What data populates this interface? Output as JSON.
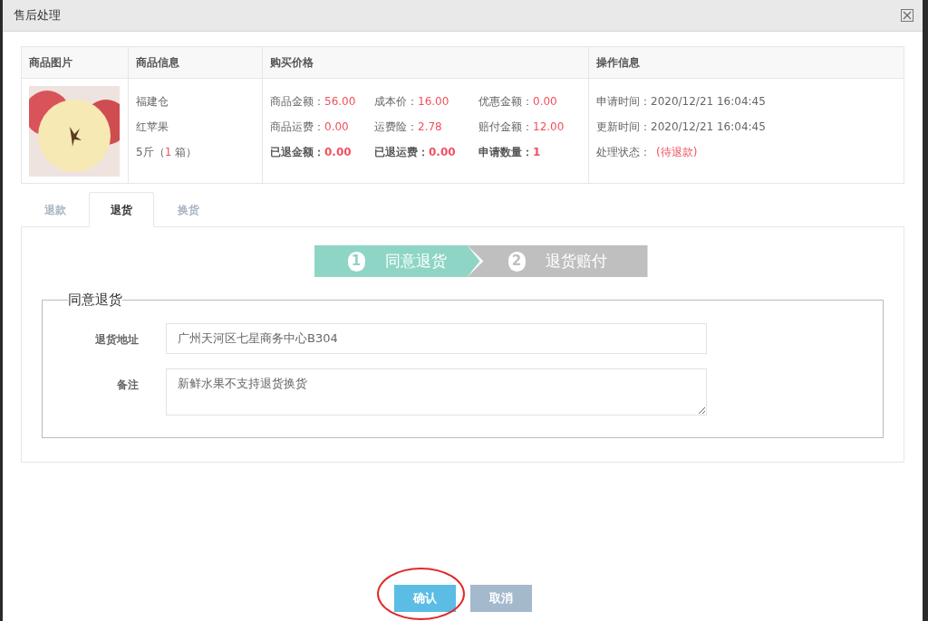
{
  "window": {
    "title": "售后处理"
  },
  "table": {
    "columns": [
      "商品图片",
      "商品信息",
      "购买价格",
      "操作信息"
    ],
    "product": {
      "lines": [
        "福建仓",
        "红苹果"
      ],
      "qty_prefix": "5斤（",
      "qty": "1",
      "qty_suffix": " 箱）"
    },
    "price_rows": [
      {
        "bold": false,
        "items": [
          {
            "label": "商品金额：",
            "value": "56.00"
          },
          {
            "label": "成本价：",
            "value": "16.00"
          },
          {
            "label": "优惠金额：",
            "value": "0.00"
          }
        ]
      },
      {
        "bold": false,
        "items": [
          {
            "label": "商品运费：",
            "value": "0.00"
          },
          {
            "label": "运费险：",
            "value": "2.78"
          },
          {
            "label": "赔付金额：",
            "value": "12.00"
          }
        ]
      },
      {
        "bold": true,
        "items": [
          {
            "label": "已退金额：",
            "value": "0.00"
          },
          {
            "label": "已退运费：",
            "value": "0.00"
          },
          {
            "label": "申请数量：",
            "value": "1"
          }
        ]
      }
    ],
    "operation": [
      {
        "label": "申请时间：",
        "value": "2020/12/21 16:04:45",
        "highlight": false
      },
      {
        "label": "更新时间：",
        "value": "2020/12/21 16:04:45",
        "highlight": false
      },
      {
        "label": "处理状态：",
        "value": "(待退款)",
        "highlight": true
      }
    ]
  },
  "tabs": [
    {
      "label": "退款",
      "selected": false
    },
    {
      "label": "退货",
      "selected": true
    },
    {
      "label": "换货",
      "selected": false
    }
  ],
  "steps": [
    {
      "number": "1",
      "label": "同意退货",
      "selected": true
    },
    {
      "number": "2",
      "label": "退货赔付",
      "selected": false
    }
  ],
  "form": {
    "legend": "同意退货",
    "fields": [
      {
        "kind": "input",
        "label": "退货地址",
        "value": "广州天河区七星商务中心B304"
      },
      {
        "kind": "textarea",
        "label": "备注",
        "value": "新鲜水果不支持退货换货"
      }
    ]
  },
  "buttons": [
    {
      "label": "确认",
      "kind": "primary"
    },
    {
      "label": "取消",
      "kind": "secondary"
    }
  ]
}
